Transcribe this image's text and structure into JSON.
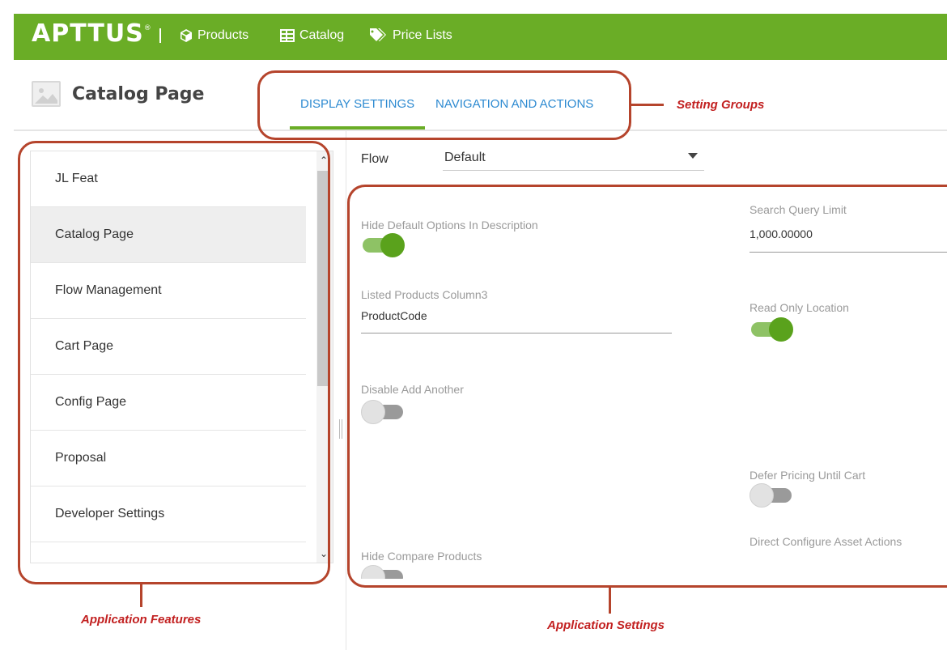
{
  "topbar": {
    "logo": "APTTUS",
    "nav": [
      {
        "icon": "cube-icon",
        "label": "Products"
      },
      {
        "icon": "grid-icon",
        "label": "Catalog"
      },
      {
        "icon": "tag-icon",
        "label": "Price Lists"
      }
    ],
    "color": "#6aad26"
  },
  "header": {
    "title": "Catalog Page",
    "tabs": [
      {
        "label": "DISPLAY SETTINGS",
        "active": true
      },
      {
        "label": "NAVIGATION AND ACTIONS",
        "active": false
      }
    ]
  },
  "features": [
    {
      "label": "JL Feat"
    },
    {
      "label": "Catalog Page",
      "active": true
    },
    {
      "label": "Flow Management"
    },
    {
      "label": "Cart Page"
    },
    {
      "label": "Config Page"
    },
    {
      "label": "Proposal"
    },
    {
      "label": "Developer Settings"
    }
  ],
  "flow": {
    "label": "Flow",
    "value": "Default"
  },
  "settings": {
    "hide_default_options": {
      "label": "Hide Default Options In Description",
      "on": true
    },
    "search_query_limit": {
      "label": "Search Query Limit",
      "value": "1,000.00000"
    },
    "listed_products_col3": {
      "label": "Listed Products Column3",
      "value": "ProductCode"
    },
    "read_only_location": {
      "label": "Read Only Location",
      "on": true
    },
    "disable_add_another": {
      "label": "Disable Add Another",
      "on": false
    },
    "defer_pricing": {
      "label": "Defer Pricing Until Cart",
      "on": false
    },
    "hide_compare": {
      "label": "Hide Compare Products",
      "on": false
    },
    "direct_configure": {
      "label": "Direct Configure Asset Actions"
    }
  },
  "annotations": {
    "setting_groups": "Setting Groups",
    "application_features": "Application Features",
    "application_settings": "Application Settings",
    "color": "#b5442c"
  }
}
